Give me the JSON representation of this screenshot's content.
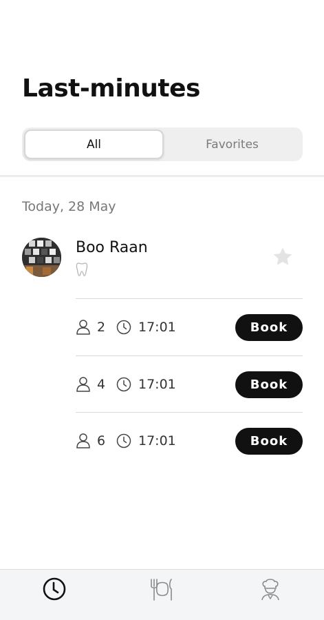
{
  "header": {
    "title": "Last-minutes"
  },
  "filter_tabs": [
    {
      "label": "All",
      "active": true
    },
    {
      "label": "Favorites",
      "active": false
    }
  ],
  "date_heading": "Today, 28 May",
  "restaurant": {
    "name": "Boo Raan",
    "cuisine_icon": "tooth-icon",
    "favorite": false,
    "favorite_icon": "star-icon",
    "favorite_color": "#e3e3e3",
    "slots": [
      {
        "people": "2",
        "time": "17:01",
        "action": "Book"
      },
      {
        "people": "4",
        "time": "17:01",
        "action": "Book"
      },
      {
        "people": "6",
        "time": "17:01",
        "action": "Book"
      }
    ]
  },
  "bottom_nav": [
    {
      "icon": "clock-icon",
      "active": true
    },
    {
      "icon": "plate-cutlery-icon",
      "active": false
    },
    {
      "icon": "chef-icon",
      "active": false
    }
  ],
  "colors": {
    "accent": "#111111",
    "muted_text": "#777777",
    "nav_background": "#f4f5f6"
  }
}
